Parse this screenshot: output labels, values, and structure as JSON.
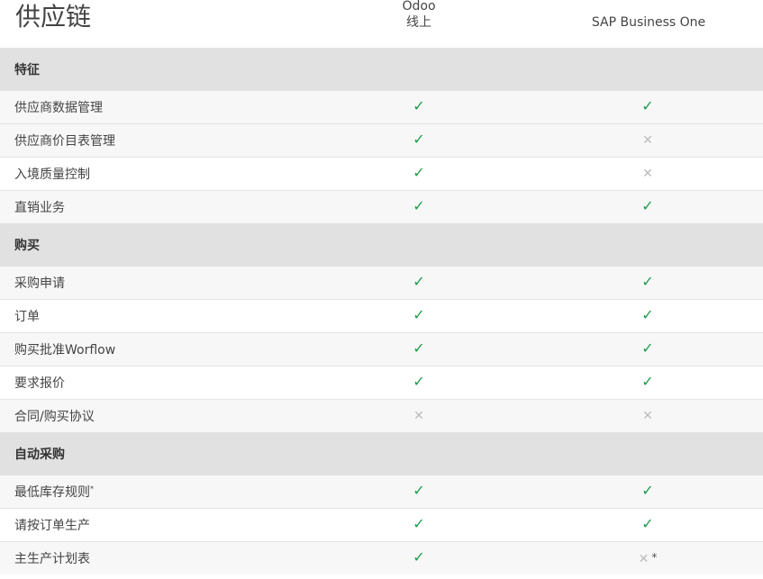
{
  "page_title": "供应链",
  "columns": {
    "odoo_line1": "Odoo",
    "odoo_line2": "线上",
    "sap": "SAP Business One"
  },
  "icons": {
    "yes": "✓",
    "no": "✕",
    "yes_icon_name": "checkmark-icon",
    "no_icon_name": "cross-icon",
    "yes_color": "#1e9c4c",
    "no_color": "#bbbbbb"
  },
  "sections": [
    {
      "title": "特征",
      "rows": [
        {
          "feature": "供应商数据管理",
          "odoo": "✓",
          "sap": "✓"
        },
        {
          "feature": "供应商价目表管理",
          "odoo": "✓",
          "sap": "✕"
        },
        {
          "feature": "入境质量控制",
          "odoo": "✓",
          "sap": "✕"
        },
        {
          "feature": "直销业务",
          "odoo": "✓",
          "sap": "✓"
        }
      ]
    },
    {
      "title": "购买",
      "rows": [
        {
          "feature": "采购申请",
          "odoo": "✓",
          "sap": "✓"
        },
        {
          "feature": "订单",
          "odoo": "✓",
          "sap": "✓"
        },
        {
          "feature": "购买批准Worflow",
          "odoo": "✓",
          "sap": "✓"
        },
        {
          "feature": "要求报价",
          "odoo": "✓",
          "sap": "✓"
        },
        {
          "feature": "合同/购买协议",
          "odoo": "✕",
          "sap": "✕"
        }
      ]
    },
    {
      "title": "自动采购",
      "rows": [
        {
          "feature": "最低库存规则",
          "feature_note": "*",
          "odoo": "✓",
          "sap": "✓"
        },
        {
          "feature": "请按订单生产",
          "odoo": "✓",
          "sap": "✓"
        },
        {
          "feature": "主生产计划表",
          "odoo": "✓",
          "sap": "✕",
          "sap_note": "*"
        }
      ]
    }
  ]
}
